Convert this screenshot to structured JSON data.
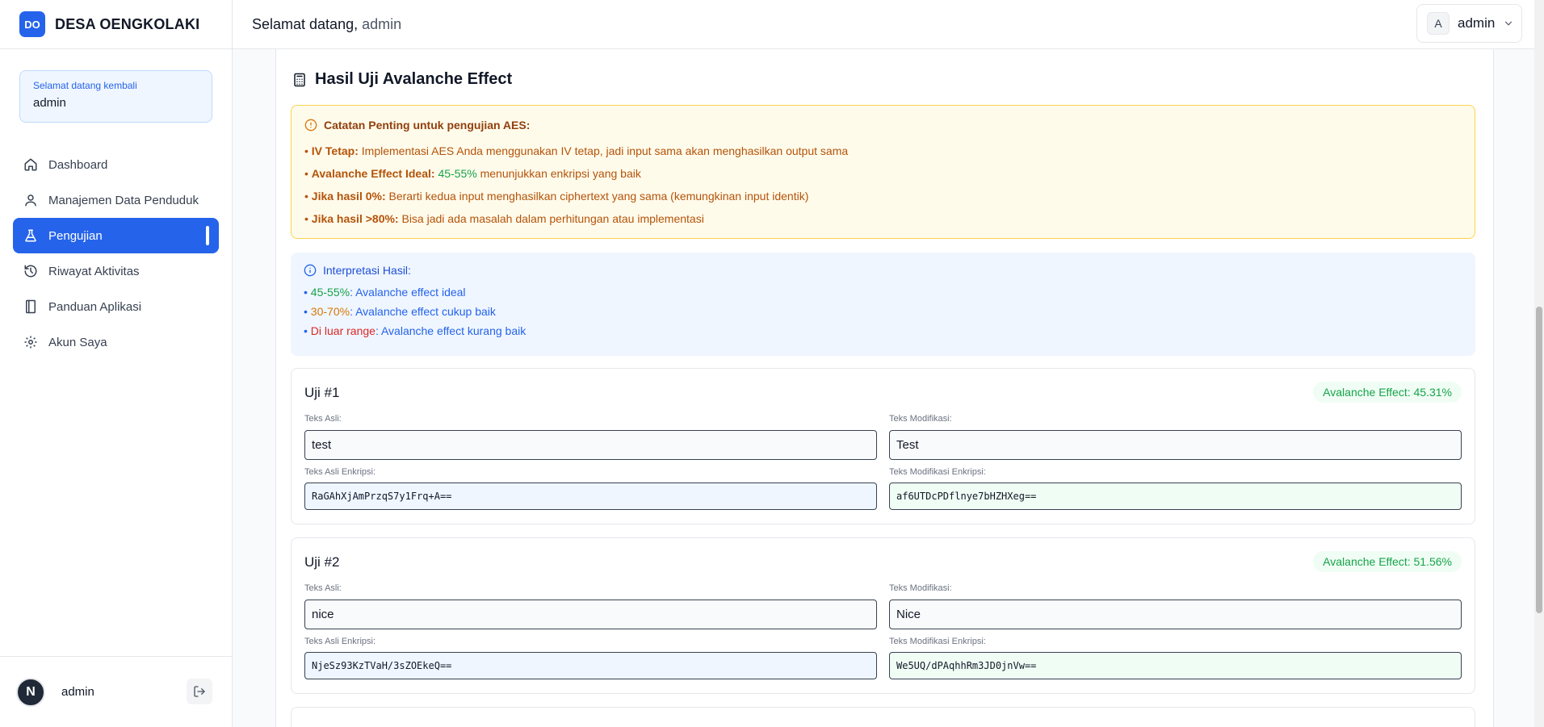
{
  "brand": {
    "logo": "DO",
    "name": "DESA OENGKOLAKI"
  },
  "welcome": {
    "small": "Selamat datang kembali",
    "name": "admin"
  },
  "nav": [
    {
      "label": "Dashboard",
      "icon": "home-icon"
    },
    {
      "label": "Manajemen Data Penduduk",
      "icon": "user-icon"
    },
    {
      "label": "Pengujian",
      "icon": "flask-icon",
      "active": true
    },
    {
      "label": "Riwayat Aktivitas",
      "icon": "history-icon"
    },
    {
      "label": "Panduan Aplikasi",
      "icon": "book-icon"
    },
    {
      "label": "Akun Saya",
      "icon": "gear-icon"
    }
  ],
  "footer": {
    "avatar": "N",
    "name": "admin"
  },
  "header": {
    "greeting": "Selamat datang,",
    "user": "admin",
    "menu_initial": "A",
    "menu_name": "admin"
  },
  "section": {
    "title": "Hasil Uji Avalanche Effect"
  },
  "note": {
    "title": "Catatan Penting untuk pengujian AES:",
    "lines": [
      {
        "bullet": "• ",
        "label": "IV Tetap:",
        "text": " Implementasi AES Anda menggunakan IV tetap, jadi input sama akan menghasilkan output sama"
      },
      {
        "bullet": "• ",
        "label": "Avalanche Effect Ideal:",
        "highlight": " 45-55%",
        "text": " menunjukkan enkripsi yang baik"
      },
      {
        "bullet": "• ",
        "label": "Jika hasil 0%:",
        "text": " Berarti kedua input menghasilkan ciphertext yang sama (kemungkinan input identik)"
      },
      {
        "bullet": "• ",
        "label": "Jika hasil >80%:",
        "text": " Bisa jadi ada masalah dalam perhitungan atau implementasi"
      }
    ]
  },
  "interpretation": {
    "title": "Interpretasi Hasil:",
    "lines": [
      {
        "bullet": "• ",
        "range": "45-55%",
        "text": ": Avalanche effect ideal",
        "color": "#16a34a"
      },
      {
        "bullet": "• ",
        "range": "30-70%",
        "text": ": Avalanche effect cukup baik",
        "color": "#d97706"
      },
      {
        "bullet": "• ",
        "range": "Di luar range",
        "text": ": Avalanche effect kurang baik",
        "color": "#dc2626"
      }
    ]
  },
  "labels": {
    "original": "Teks Asli:",
    "modified": "Teks Modifikasi:",
    "original_enc": "Teks Asli Enkripsi:",
    "modified_enc": "Teks Modifikasi Enkripsi:"
  },
  "tests": [
    {
      "title": "Uji #1",
      "badge": "Avalanche Effect: 45.31%",
      "original": "test",
      "modified": "Test",
      "original_enc": "RaGAhXjAmPrzqS7y1Frq+A==",
      "modified_enc": "af6UTDcPDflnye7bHZHXeg=="
    },
    {
      "title": "Uji #2",
      "badge": "Avalanche Effect: 51.56%",
      "original": "nice",
      "modified": "Nice",
      "original_enc": "NjeSz93KzTVaH/3sZOEkeQ==",
      "modified_enc": "We5UQ/dPAqhhRm3JD0jnVw=="
    }
  ]
}
